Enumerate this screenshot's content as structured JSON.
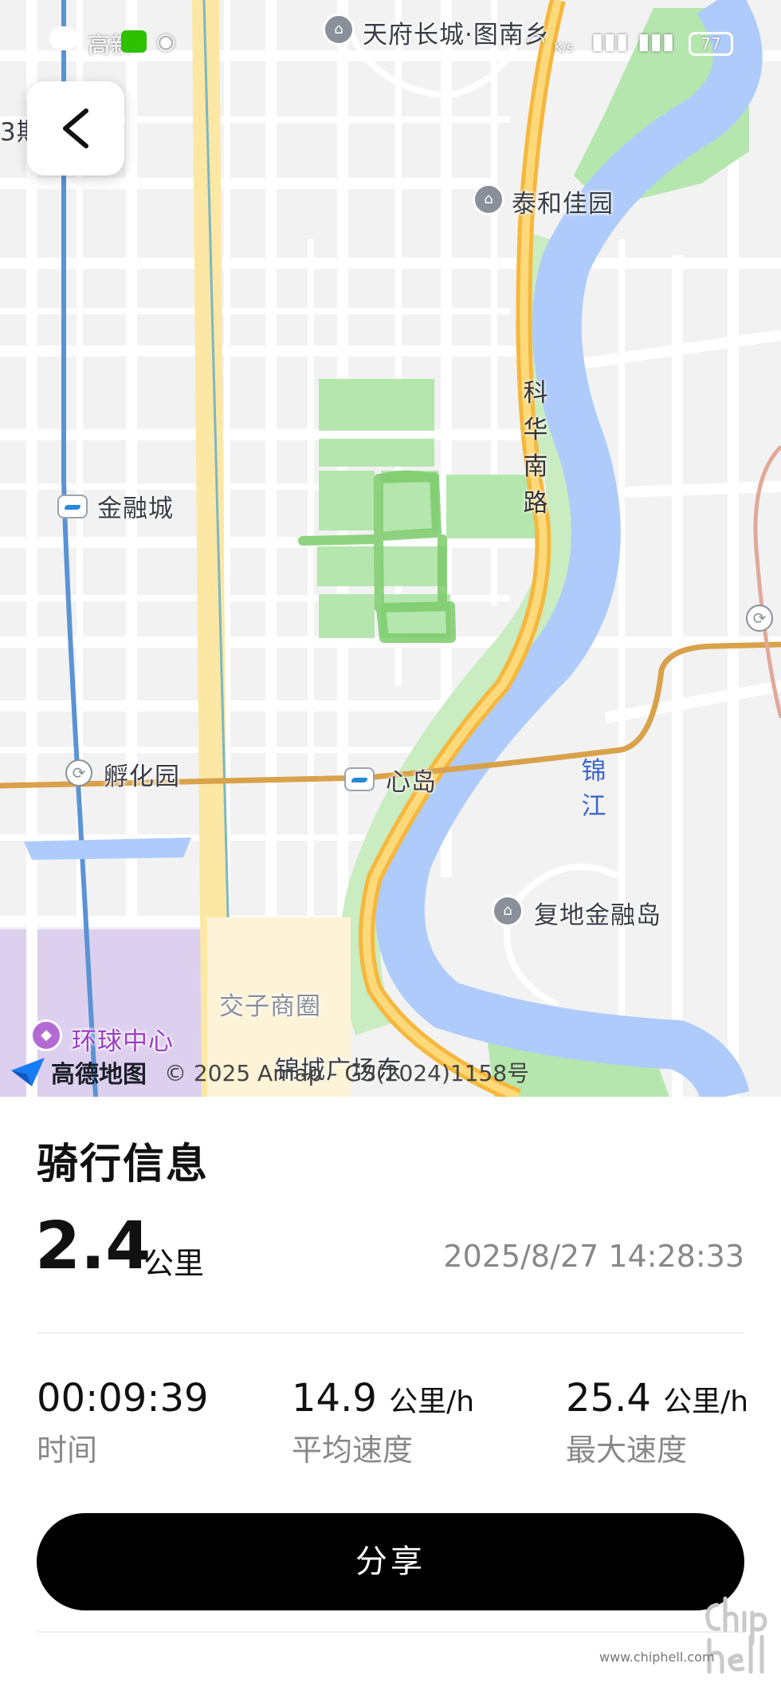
{
  "status_bar": {
    "left_text": "高新",
    "battery": "77",
    "net_speed": "K/s"
  },
  "map": {
    "labels": {
      "tianfu": "天府长城·图南乡",
      "taihe": "泰和佳园",
      "jinrongcheng": "金融城",
      "fuhuayuan": "孵化园",
      "xindao": "心岛",
      "fudi": "复地金融岛",
      "jiaozi": "交子商圈",
      "huanqiu": "环球中心",
      "jincheng": "锦城广场东",
      "partial_left": "3期"
    },
    "road_kehua": [
      "科",
      "华",
      "南",
      "路"
    ],
    "river_jinjiang": [
      "锦",
      "江"
    ],
    "attribution_logo": "高德地图",
    "copyright": "© 2025 Amap - GS(2024)1158号",
    "colors": {
      "background": "#f2f2f3",
      "road": "#ffffff",
      "river": "#aecbfb",
      "park": "#b5e6ae",
      "highway": "#fbc94e",
      "rail": "#d9a24a",
      "metro_line": "#5b93d4",
      "track": "#7ccc6b"
    }
  },
  "panel": {
    "title": "骑行信息",
    "distance_value": "2.4",
    "distance_unit": "公里",
    "datetime": "2025/8/27 14:28:33",
    "stats": [
      {
        "value": "00:09:39",
        "unit": "",
        "label": "时间"
      },
      {
        "value": "14.9",
        "unit": "公里/h",
        "label": "平均速度"
      },
      {
        "value": "25.4",
        "unit": "公里/h",
        "label": "最大速度"
      }
    ],
    "share_label": "分享"
  },
  "watermark": {
    "text": "www.chiphell.com",
    "logo_text": "chip hell"
  }
}
